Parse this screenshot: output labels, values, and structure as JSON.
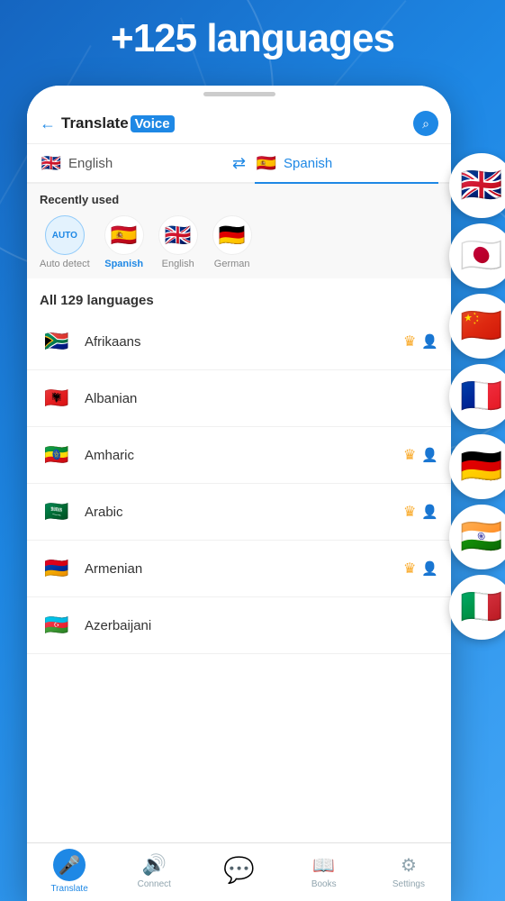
{
  "header": {
    "title": "+125 languages"
  },
  "app_bar": {
    "back_label": "←",
    "logo_translate": "Translate",
    "logo_voice": "Voice",
    "search_icon": "C"
  },
  "lang_selector": {
    "source_lang": "English",
    "source_flag": "🇬🇧",
    "swap_icon": "⇄",
    "target_lang": "Spanish",
    "target_flag": "🇪🇸"
  },
  "recently_used": {
    "title": "Recently used",
    "items": [
      {
        "label": "Auto detect",
        "type": "auto",
        "text": "AUTO"
      },
      {
        "label": "Spanish",
        "type": "flag",
        "flag": "🇪🇸",
        "highlight": true
      },
      {
        "label": "English",
        "type": "flag",
        "flag": "🇬🇧"
      },
      {
        "label": "German",
        "type": "flag",
        "flag": "🇩🇪"
      }
    ]
  },
  "all_languages": {
    "title": "All 129 languages",
    "items": [
      {
        "name": "Afrikaans",
        "flag": "🇿🇦",
        "crown": true,
        "voice": true
      },
      {
        "name": "Albanian",
        "flag": "🇦🇱",
        "crown": false,
        "voice": false
      },
      {
        "name": "Amharic",
        "flag": "🇪🇹",
        "crown": true,
        "voice": true
      },
      {
        "name": "Arabic",
        "flag": "🇸🇦",
        "crown": true,
        "voice": true
      },
      {
        "name": "Armenian",
        "flag": "🇦🇲",
        "crown": true,
        "voice": true
      },
      {
        "name": "Azerbaijani",
        "flag": "🇦🇿",
        "crown": false,
        "voice": false
      }
    ]
  },
  "float_flags": [
    "🇬🇧",
    "🇯🇵",
    "🇨🇳",
    "🇫🇷",
    "🇩🇪",
    "🇮🇳",
    "🇮🇹"
  ],
  "bottom_nav": {
    "items": [
      {
        "label": "Translate",
        "active": true,
        "icon": "🎤"
      },
      {
        "label": "Connect",
        "active": false,
        "icon": "🔊"
      },
      {
        "label": "",
        "active": false,
        "icon": "💬",
        "center": true
      },
      {
        "label": "Books",
        "active": false,
        "icon": "📖"
      },
      {
        "label": "Settings",
        "active": false,
        "icon": "⚙"
      }
    ]
  }
}
